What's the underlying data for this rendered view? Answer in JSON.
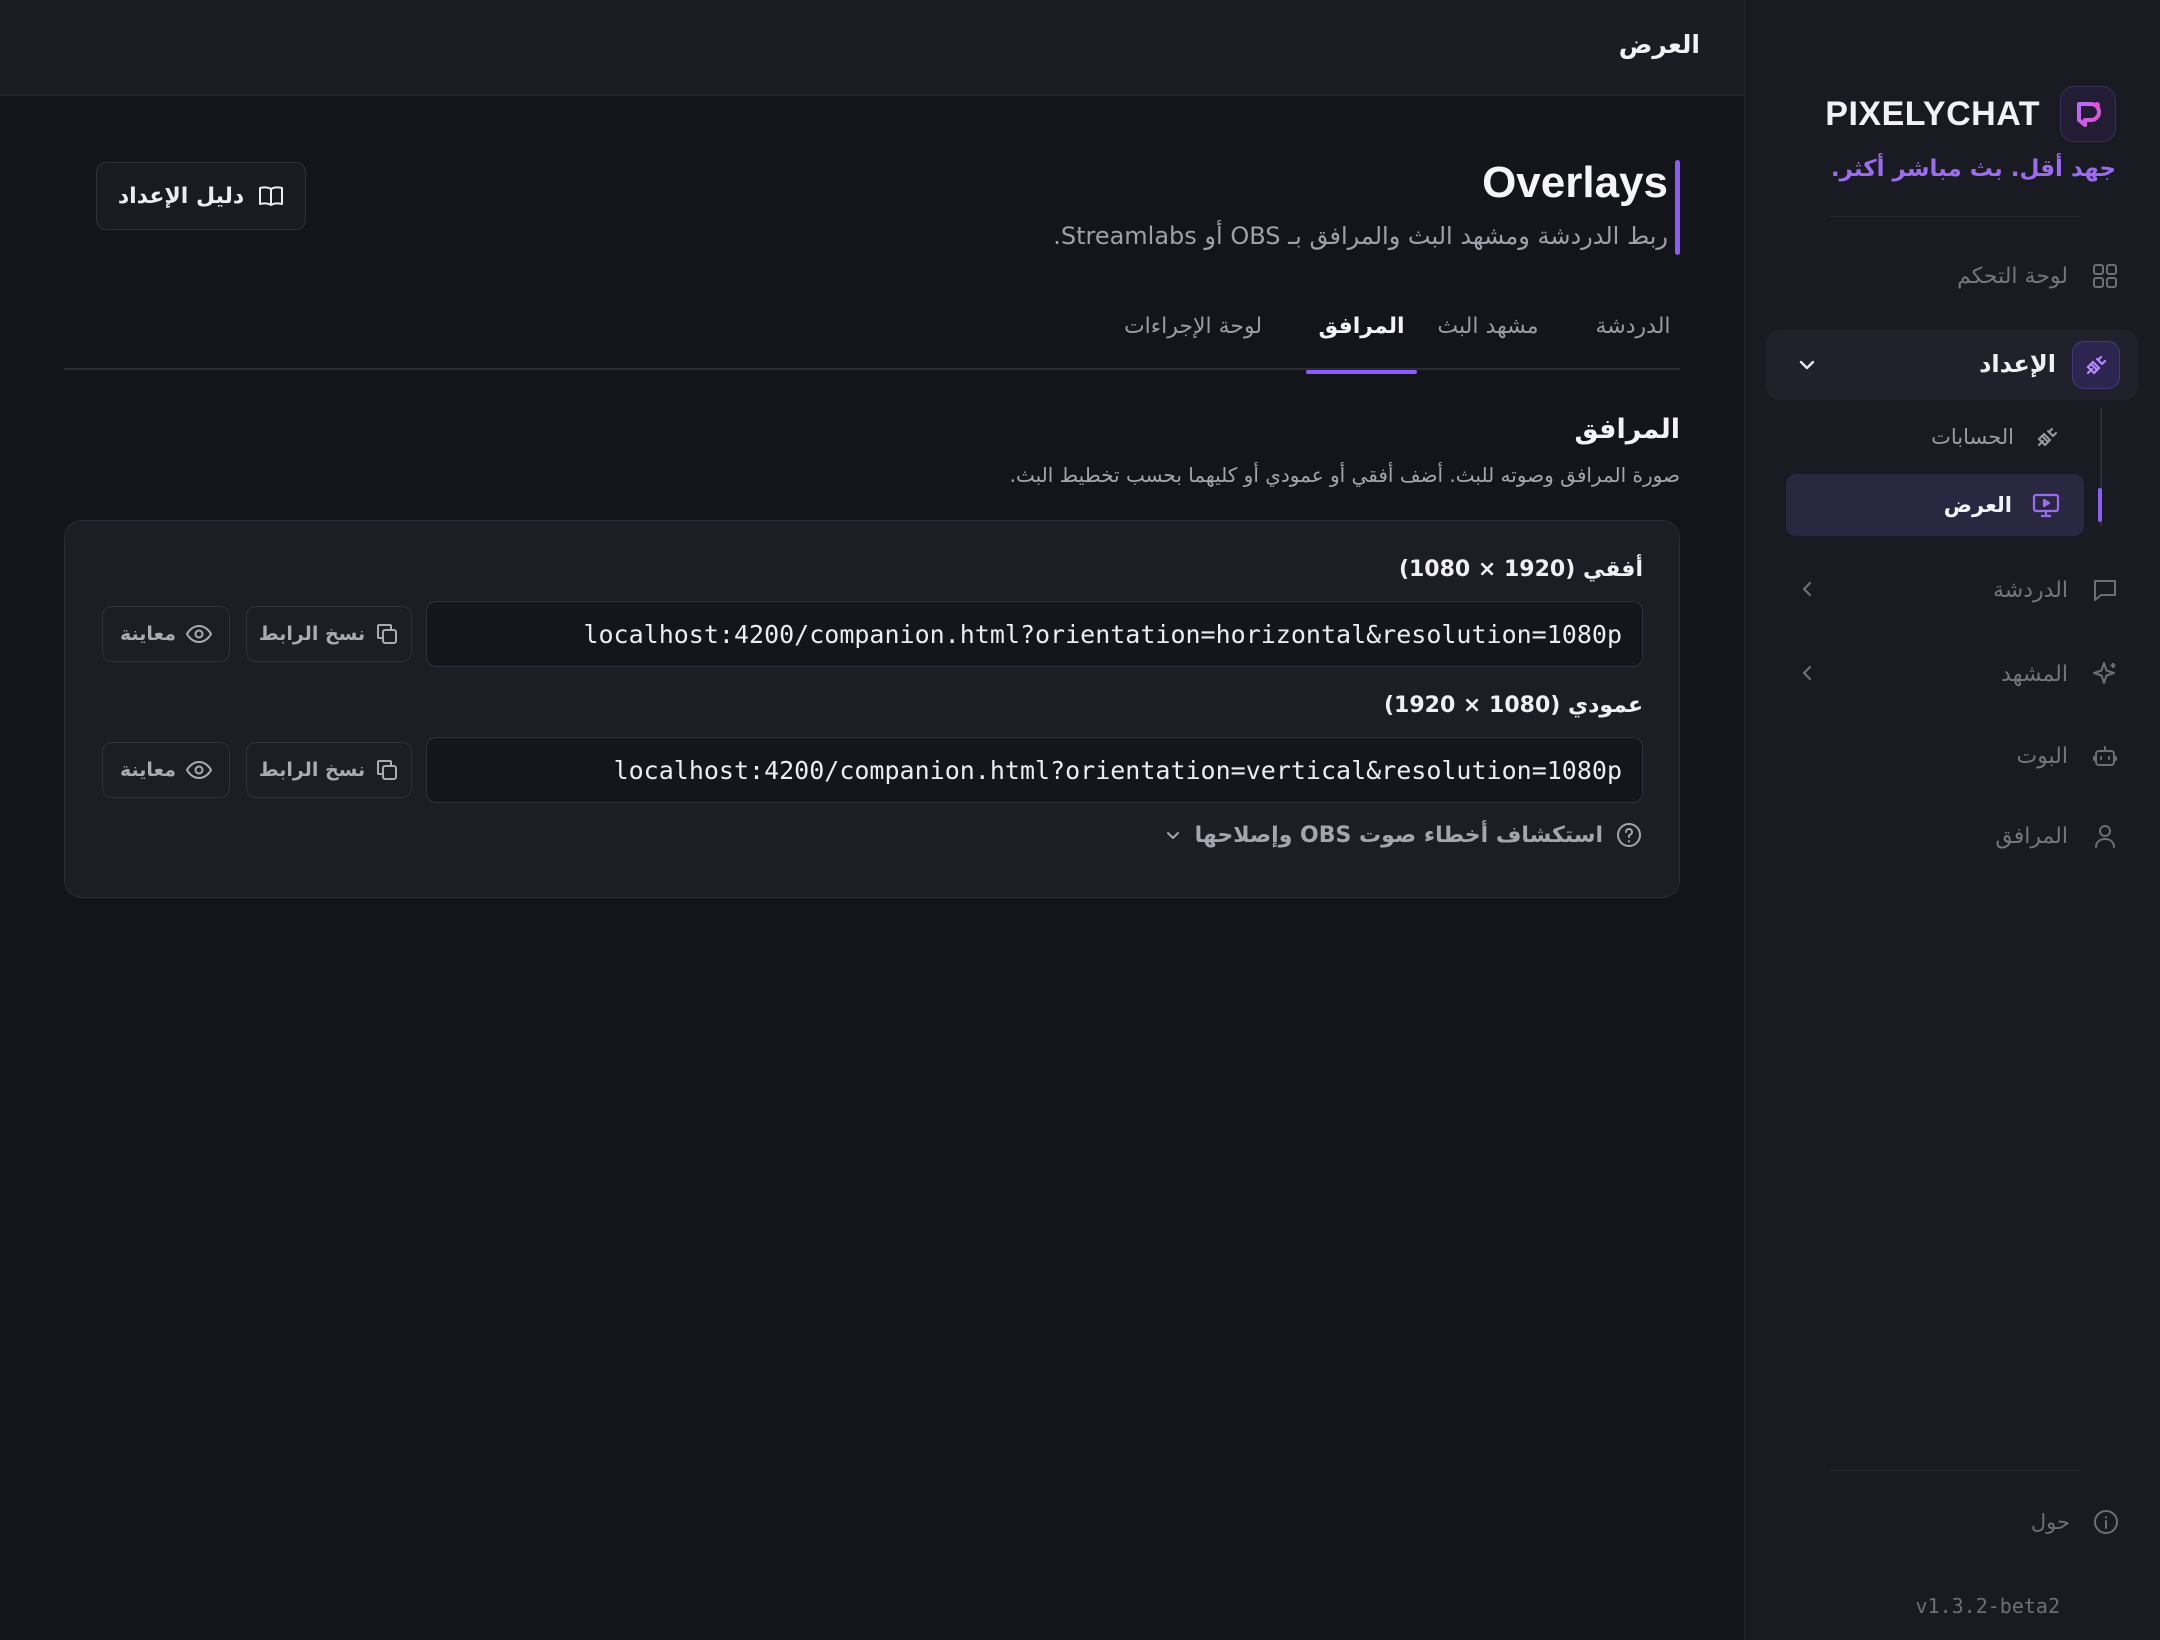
{
  "app": {
    "name": "PIXELYCHAT",
    "tagline": "جهد أقل. بث مباشر أكثر.",
    "version": "v1.3.2-beta2",
    "accent_color": "#8b5cf6"
  },
  "sidebar": {
    "dashboard": {
      "label": "لوحة التحكم",
      "icon": "grid-icon"
    },
    "setup": {
      "label": "الإعداد",
      "icon": "plug-icon",
      "expanded": true,
      "children": [
        {
          "label": "الحسابات",
          "icon": "plug-icon",
          "active": false
        },
        {
          "label": "العرض",
          "icon": "monitor-play-icon",
          "active": true
        }
      ]
    },
    "chat": {
      "label": "الدردشة",
      "icon": "chat-bubble-icon"
    },
    "scene": {
      "label": "المشهد",
      "icon": "sparkles-icon"
    },
    "bot": {
      "label": "البوت",
      "icon": "robot-icon"
    },
    "companion": {
      "label": "المرافق",
      "icon": "user-icon"
    },
    "about": {
      "label": "حول",
      "icon": "info-icon"
    }
  },
  "topbar": {
    "title": "العرض"
  },
  "page": {
    "title": "Overlays",
    "subtitle": "ربط الدردشة ومشهد البث والمرافق بـ OBS أو Streamlabs.",
    "guide_button": "دليل الإعداد"
  },
  "tabs": [
    {
      "label": "الدردشة",
      "active": false
    },
    {
      "label": "مشهد البث",
      "active": false
    },
    {
      "label": "المرافق",
      "active": true
    },
    {
      "label": "لوحة الإجراءات",
      "active": false
    }
  ],
  "section": {
    "title": "المرافق",
    "description": "صورة المرافق وصوته للبث. أضف أفقي أو عمودي أو كليهما بحسب تخطيط البث."
  },
  "overlays": [
    {
      "label": "أفقي (1920 × 1080)",
      "url": "localhost:4200/companion.html?orientation=horizontal&resolution=1080p",
      "copy_label": "نسخ الرابط",
      "preview_label": "معاينة"
    },
    {
      "label": "عمودي (1080 × 1920)",
      "url": "localhost:4200/companion.html?orientation=vertical&resolution=1080p",
      "copy_label": "نسخ الرابط",
      "preview_label": "معاينة"
    }
  ],
  "troubleshoot": {
    "label": "استكشاف أخطاء صوت OBS وإصلاحها"
  }
}
